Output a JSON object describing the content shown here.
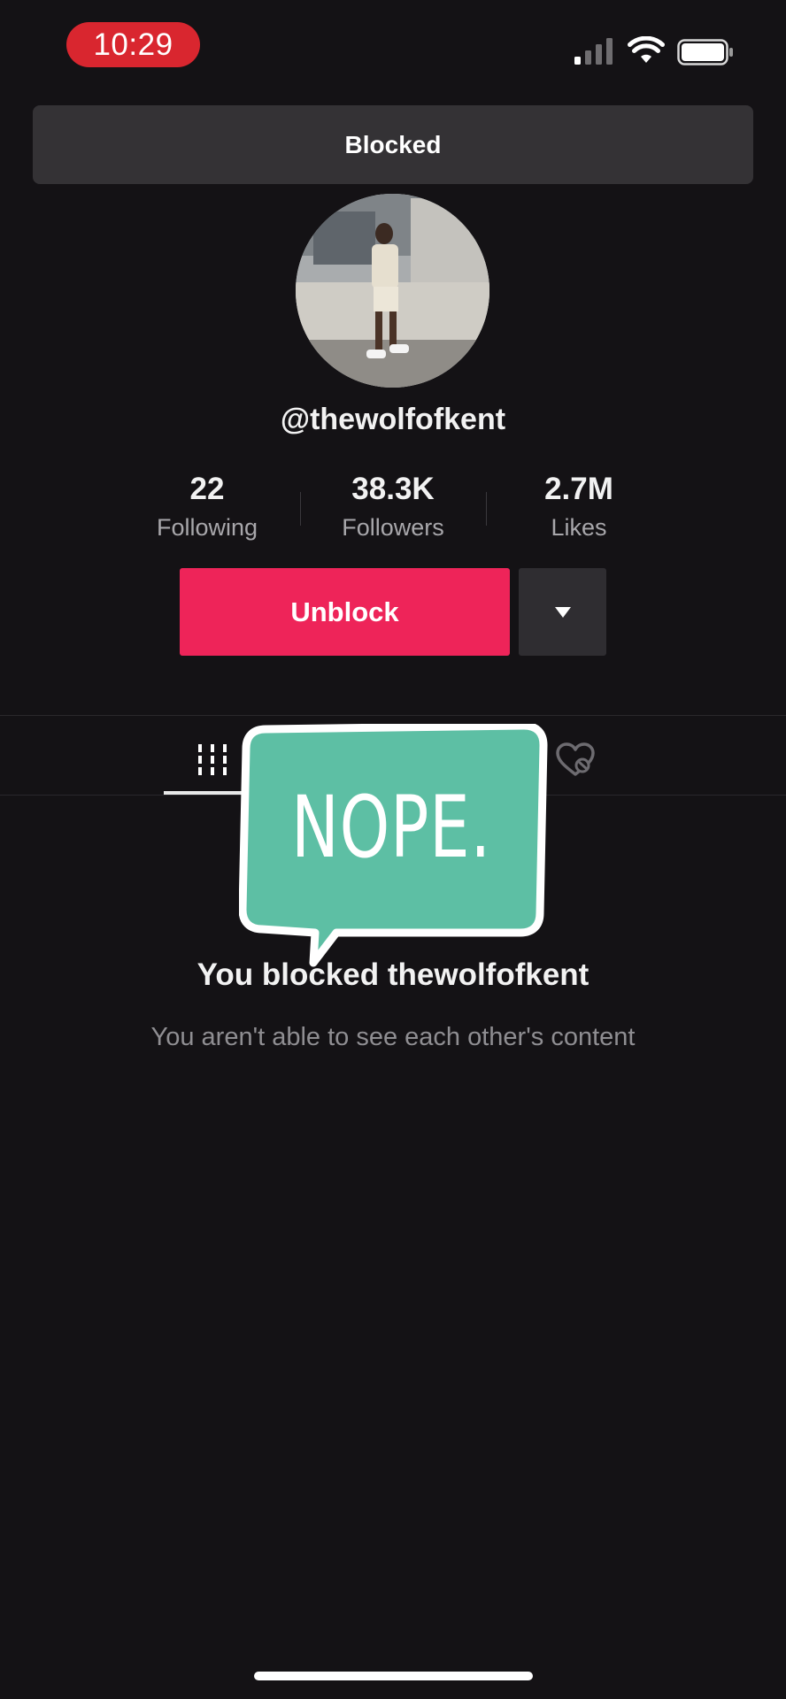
{
  "status_bar": {
    "time": "10:29",
    "time_pill_color": "#d9262f",
    "icons": [
      "signal-icon",
      "wifi-icon",
      "battery-icon"
    ]
  },
  "banner": {
    "text": "Blocked"
  },
  "profile": {
    "username": "@thewolfofkent",
    "stats": [
      {
        "value": "22",
        "label": "Following"
      },
      {
        "value": "38.3K",
        "label": "Followers"
      },
      {
        "value": "2.7M",
        "label": "Likes"
      }
    ]
  },
  "actions": {
    "unblock_label": "Unblock",
    "unblock_color": "#ee2459",
    "more_icon": "caret-down-icon"
  },
  "tabs": {
    "icons": [
      "videos-grid-icon",
      "liked-hidden-icon"
    ]
  },
  "sticker": {
    "text": "NOPE.",
    "color": "#5dbfa4"
  },
  "empty_state": {
    "title": "You blocked thewolfofkent",
    "subtitle": "You aren't able to see each other's content"
  }
}
